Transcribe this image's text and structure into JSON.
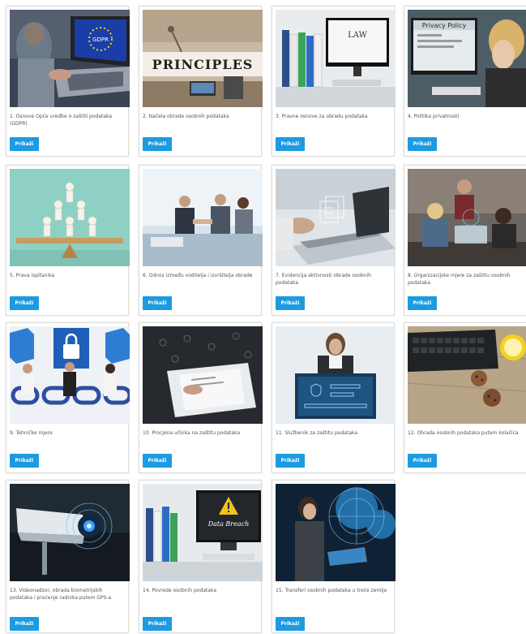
{
  "button_label": "Prikaži",
  "cards": [
    {
      "title": "1. Osnove Opće uredbe o zaštiti podataka (GDPR)",
      "image": "laptop-eu-gdpr"
    },
    {
      "title": "2. Načela obrade osobnih podataka",
      "image": "principles-blocks"
    },
    {
      "title": "3. Pravne osnove za obradu podataka",
      "image": "law-binders-monitor"
    },
    {
      "title": "4. Politika privatnosti",
      "image": "privacy-policy-screen"
    },
    {
      "title": "5. Prava ispitanika",
      "image": "people-figures-seesaw"
    },
    {
      "title": "6. Odnos između voditelja i izvršitelja obrade",
      "image": "business-handshake"
    },
    {
      "title": "7. Evidencija aktivnosti obrade osobnih podataka",
      "image": "laptop-digital-records"
    },
    {
      "title": "8. Organizacijske mjere za zaštitu osobnih podataka",
      "image": "team-meeting-office"
    },
    {
      "title": "9. Tehničke mjere",
      "image": "padlock-chain-blocks"
    },
    {
      "title": "10. Procjena učinka na zaštitu podataka",
      "image": "tablet-document-locks"
    },
    {
      "title": "11. Službenik za zaštitu podataka",
      "image": "woman-security-screen"
    },
    {
      "title": "12. Obrada osobnih podataka putem kolačića",
      "image": "keyboard-cookies-mug"
    },
    {
      "title": "13. Videonadzor, obrada biometrijskih podataka i praćenje radnika putem GPS-a",
      "image": "security-camera"
    },
    {
      "title": "14. Povrede osobnih podataka",
      "image": "data-breach-warning"
    },
    {
      "title": "15. Transferi osobnih podataka u treće zemlje",
      "image": "woman-laptop-global-network"
    }
  ],
  "image_texts": {
    "gdpr_flag": "GDPR",
    "principles": "PRINCIPLES",
    "law": "LAW",
    "privacy_policy": "Privacy Policy",
    "data_breach": "Data Breach"
  }
}
